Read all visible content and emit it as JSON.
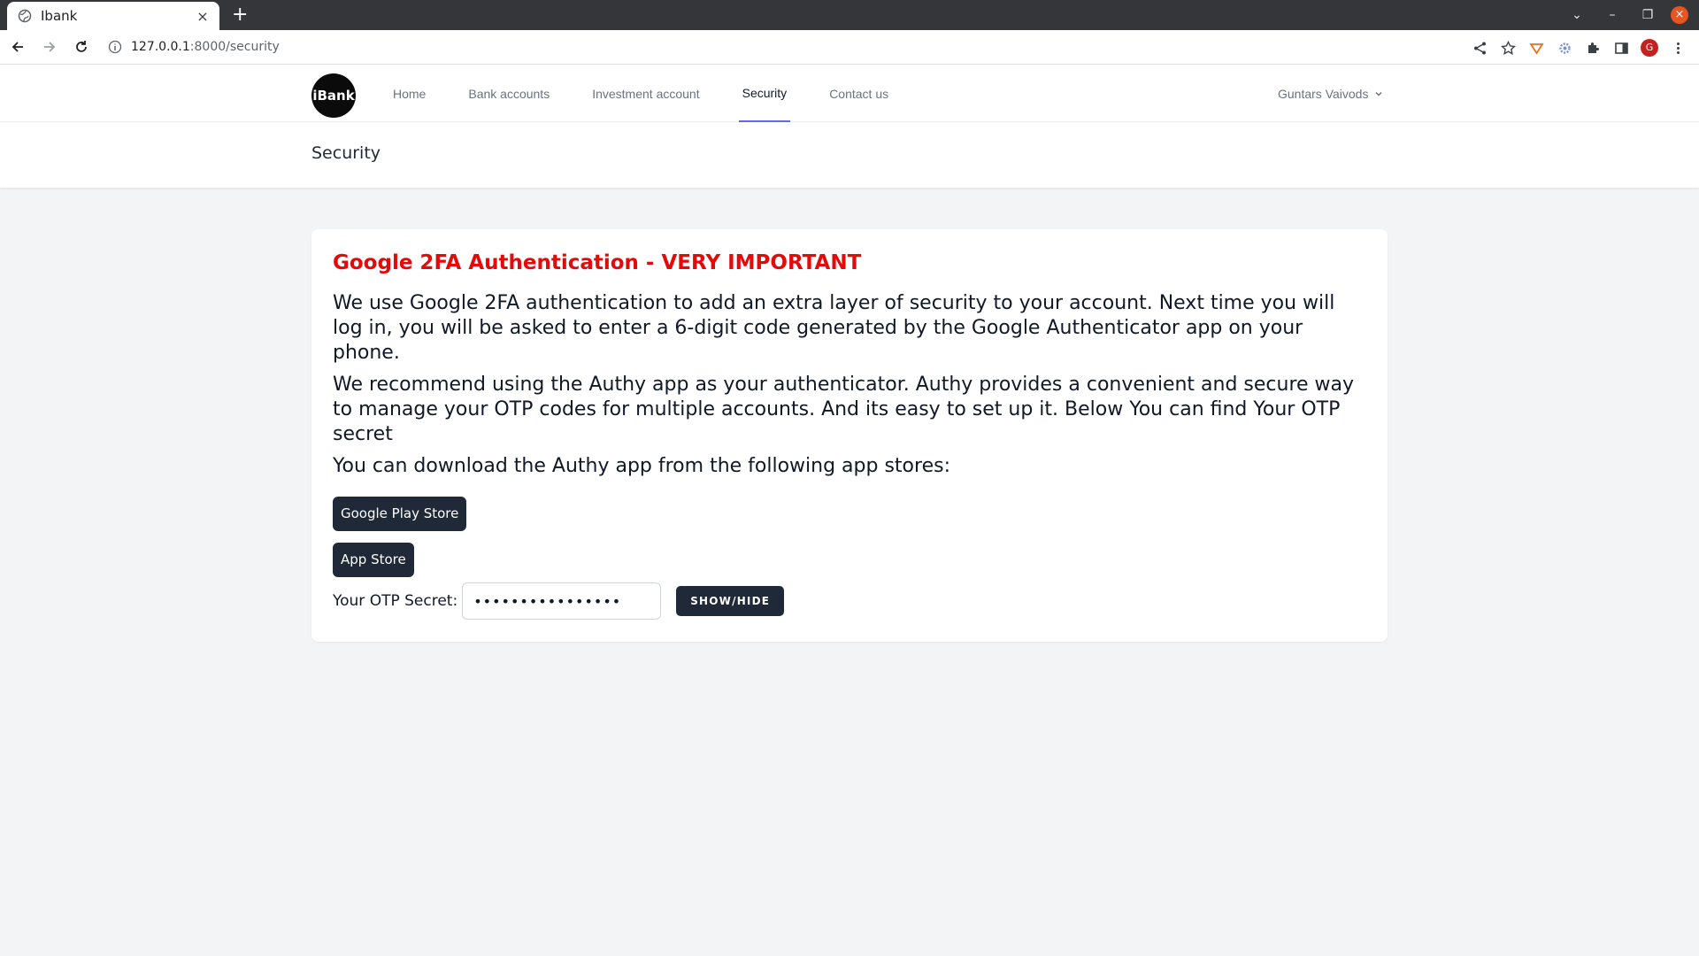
{
  "browser": {
    "tab_title": "Ibank",
    "tab_close": "×",
    "new_tab": "+",
    "url_host": "127.0.0.1",
    "url_path": ":8000/security",
    "profile_initial": "G",
    "window_controls": {
      "chevron": "⌄",
      "minimize": "–",
      "restore": "❐",
      "close": "×"
    }
  },
  "nav": {
    "logo": "iBank",
    "links": [
      "Home",
      "Bank accounts",
      "Investment account",
      "Security",
      "Contact us"
    ],
    "active": "Security",
    "user": "Guntars Vaivods"
  },
  "header": {
    "title": "Security"
  },
  "card": {
    "heading": "Google 2FA Authentication - VERY IMPORTANT",
    "paragraph1": "We use Google 2FA authentication to add an extra layer of security to your account. Next time you will log in, you will be asked to enter a 6-digit code generated by the Google Authenticator app on your phone.",
    "paragraph2": "We recommend using the Authy app as your authenticator. Authy provides a convenient and secure way to manage your OTP codes for multiple accounts. And its easy to set up it. Below You can find Your OTP secret",
    "paragraph3": "You can download the Authy app from the following app stores:",
    "google_play_label": "Google Play Store",
    "app_store_label": "App Store",
    "otp_label": "Your OTP Secret:",
    "otp_value": "••••••••••••••••",
    "show_hide_label": "SHOW/HIDE"
  },
  "colors": {
    "heading_red": "#e40a0a",
    "button_dark": "#1f2937",
    "active_underline": "#6366f1",
    "page_bg": "#f3f4f6"
  }
}
